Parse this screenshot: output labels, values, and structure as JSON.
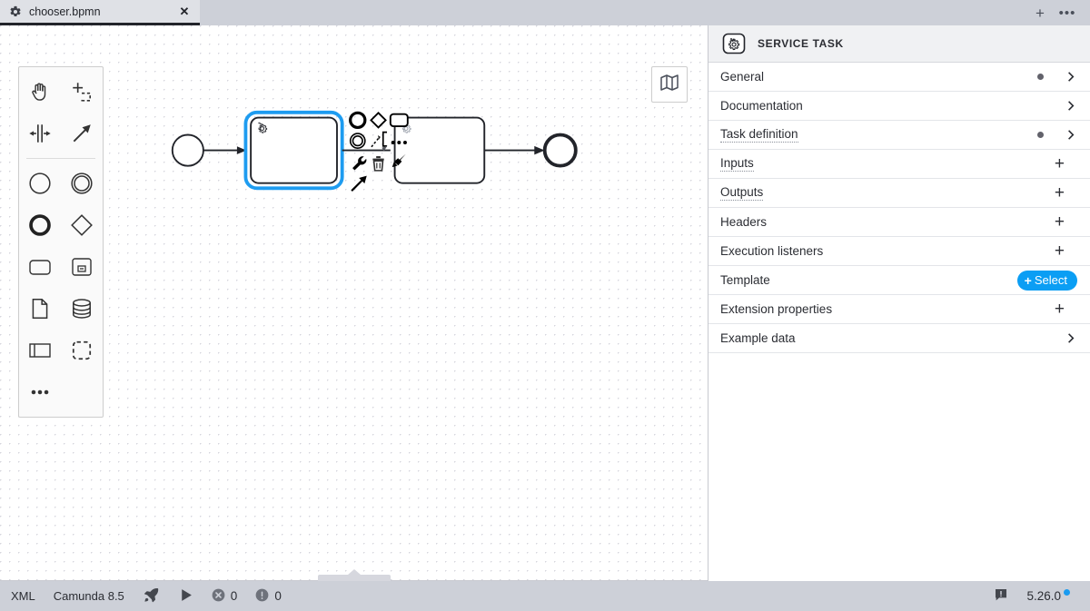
{
  "window": {
    "tabs": [
      {
        "title": "chooser.bpmn",
        "icon": "bpmn-gear-icon",
        "close": "✕",
        "active": true
      }
    ],
    "actions": {
      "new_tab": "+",
      "more": "•••"
    }
  },
  "canvas": {
    "palette": {
      "tools": [
        {
          "name": "hand-tool",
          "label": "Activate the hand tool"
        },
        {
          "name": "lasso-tool",
          "label": "Activate the lasso tool"
        },
        {
          "name": "space-tool",
          "label": "Activate the create/remove space tool"
        },
        {
          "name": "global-connect-tool",
          "label": "Activate the global connect tool"
        }
      ],
      "elements": [
        {
          "name": "create-start-event",
          "label": "Create StartEvent"
        },
        {
          "name": "create-intermediate-event",
          "label": "Create Intermediate/Boundary Event"
        },
        {
          "name": "create-end-event",
          "label": "Create EndEvent"
        },
        {
          "name": "create-gateway",
          "label": "Create Gateway"
        },
        {
          "name": "create-task",
          "label": "Create Task"
        },
        {
          "name": "create-subprocess",
          "label": "Create expanded SubProcess"
        },
        {
          "name": "create-data-object",
          "label": "Create DataObjectReference"
        },
        {
          "name": "create-data-store",
          "label": "Create DataStoreReference"
        },
        {
          "name": "create-participant",
          "label": "Create Pool/Participant"
        },
        {
          "name": "create-group",
          "label": "Create Group"
        }
      ],
      "more": "•••"
    },
    "minimap_button": "toggle-minimap",
    "diagram": {
      "elements": [
        {
          "type": "start-event",
          "name": "start-event"
        },
        {
          "type": "service-task",
          "name": "service-task-selected",
          "selected": true
        },
        {
          "type": "service-task",
          "name": "service-task-second",
          "selected": false
        },
        {
          "type": "end-event",
          "name": "end-event"
        }
      ],
      "context_pad": [
        {
          "name": "append-end-event-icon"
        },
        {
          "name": "append-gateway-icon"
        },
        {
          "name": "append-task-icon"
        },
        {
          "name": "append-intermediate-event-icon"
        },
        {
          "name": "append-text-annotation-icon"
        },
        {
          "name": "more-options-icon"
        },
        {
          "name": "replace-wrench-icon"
        },
        {
          "name": "delete-trash-icon"
        },
        {
          "name": "set-color-brush-icon"
        },
        {
          "name": "connect-arrow-icon"
        }
      ]
    }
  },
  "properties": {
    "header": {
      "icon": "service-task-icon",
      "title": "SERVICE TASK"
    },
    "groups": [
      {
        "label": "General",
        "indicator": "dot",
        "action": "chevron",
        "tooltip": false
      },
      {
        "label": "Documentation",
        "indicator": "",
        "action": "chevron",
        "tooltip": false
      },
      {
        "label": "Task definition",
        "indicator": "dot",
        "action": "chevron",
        "tooltip": true
      },
      {
        "label": "Inputs",
        "indicator": "",
        "action": "plus",
        "tooltip": true
      },
      {
        "label": "Outputs",
        "indicator": "",
        "action": "plus",
        "tooltip": true
      },
      {
        "label": "Headers",
        "indicator": "",
        "action": "plus",
        "tooltip": false
      },
      {
        "label": "Execution listeners",
        "indicator": "",
        "action": "plus",
        "tooltip": false
      },
      {
        "label": "Template",
        "indicator": "",
        "action": "select-button",
        "tooltip": false,
        "button_label": "Select",
        "button_plus": "+"
      },
      {
        "label": "Extension properties",
        "indicator": "",
        "action": "plus",
        "tooltip": false
      },
      {
        "label": "Example data",
        "indicator": "",
        "action": "chevron",
        "tooltip": false
      }
    ]
  },
  "statusbar": {
    "xml": "XML",
    "engine": "Camunda 8.5",
    "deploy_icon": "rocket-icon",
    "run_icon": "play-icon",
    "errors": "0",
    "warnings": "0",
    "notification_icon": "notification-icon",
    "version": "5.26.0"
  },
  "colors": {
    "accent": "#0b9ef4",
    "selection": "#1e9cf0",
    "chrome": "#cdd0d8",
    "panel_header": "#f0f1f3"
  }
}
